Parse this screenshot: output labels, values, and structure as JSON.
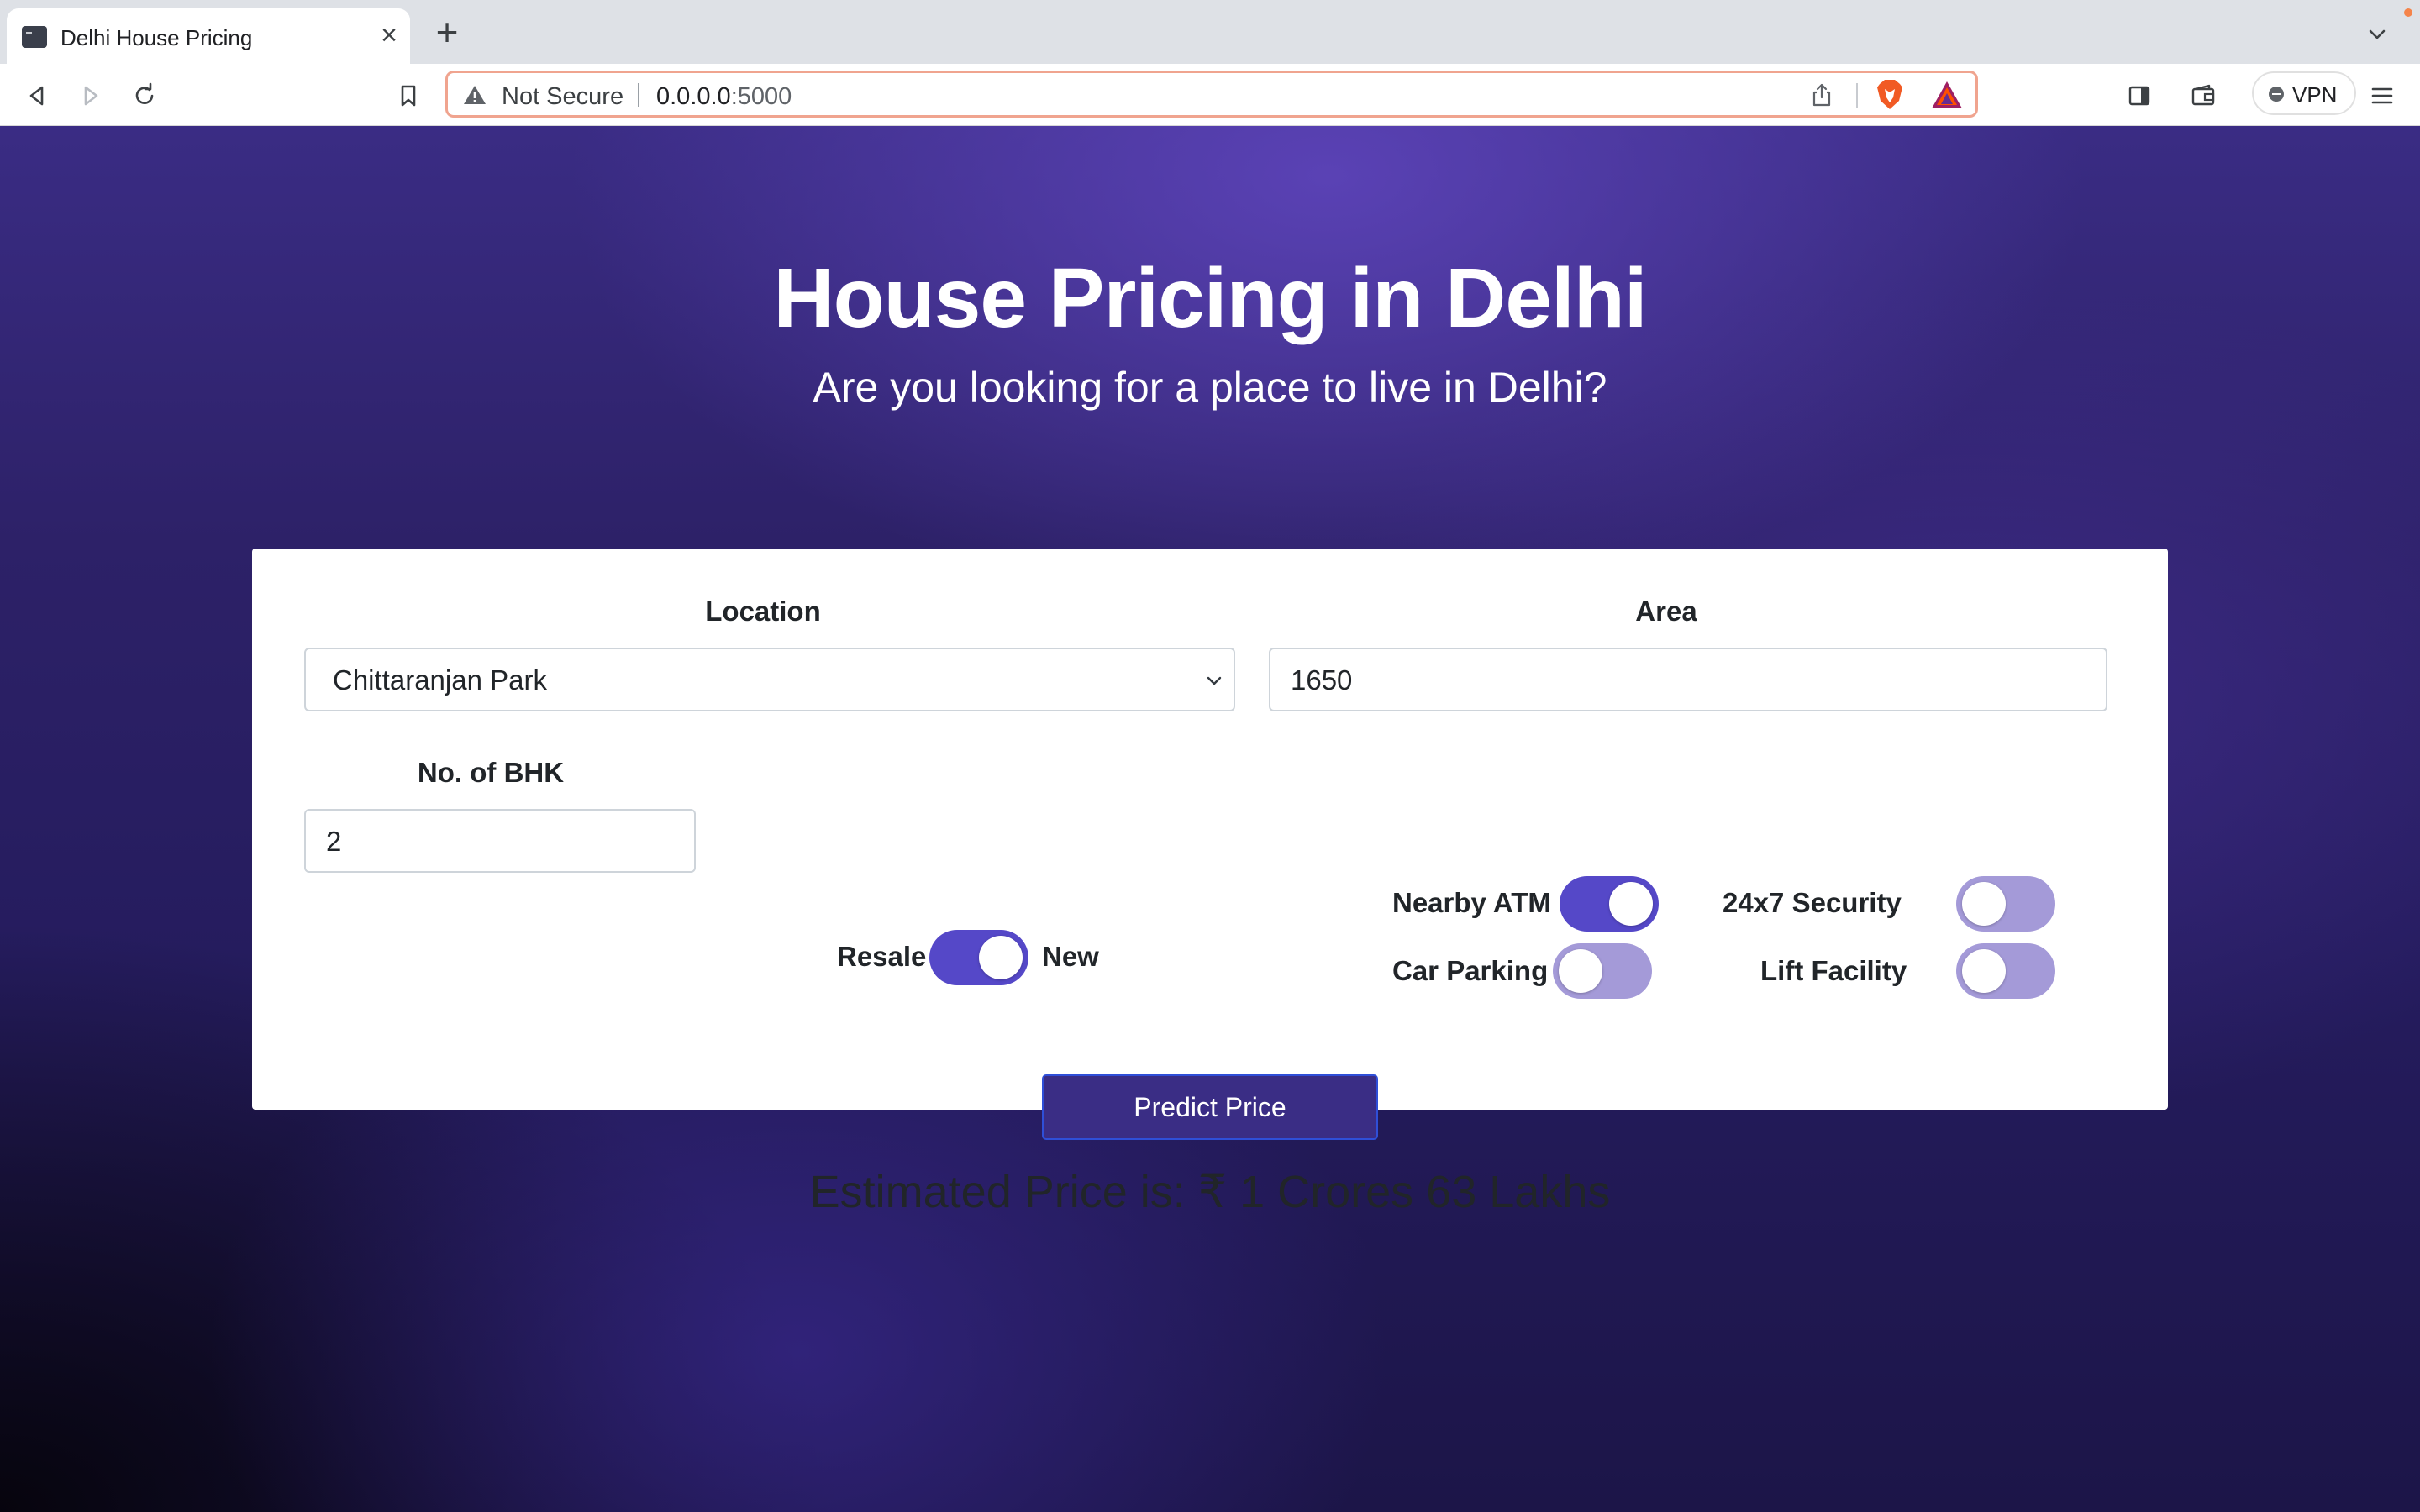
{
  "browser": {
    "tab_title": "Delhi House Pricing",
    "tab_close": "×",
    "new_tab": "+",
    "security_label": "Not Secure",
    "url_host": "0.0.0.0",
    "url_port": ":5000",
    "vpn_label": "VPN"
  },
  "hero": {
    "title": "House Pricing in Delhi",
    "subtitle": "Are you looking for a place to live in Delhi?"
  },
  "form": {
    "location_label": "Location",
    "location_value": "Chittaranjan Park",
    "area_label": "Area",
    "area_value": "1650",
    "bhk_label": "No. of BHK",
    "bhk_value": "2",
    "resale_label": "Resale",
    "new_label": "New",
    "resale_new_on": true,
    "options": {
      "nearby_atm": {
        "label": "Nearby ATM",
        "on": true
      },
      "security": {
        "label": "24x7 Security",
        "on": false
      },
      "car_parking": {
        "label": "Car Parking",
        "on": false
      },
      "lift": {
        "label": "Lift Facility",
        "on": false
      }
    },
    "predict_button": "Predict Price",
    "result_text": "Estimated Price is: ₹ 1 Crores 63 Lakhs"
  },
  "colors": {
    "switch_on": "#5548c8",
    "switch_off": "#a49ad8",
    "button": "#3a2d85",
    "page_bg": "#2d2168"
  }
}
